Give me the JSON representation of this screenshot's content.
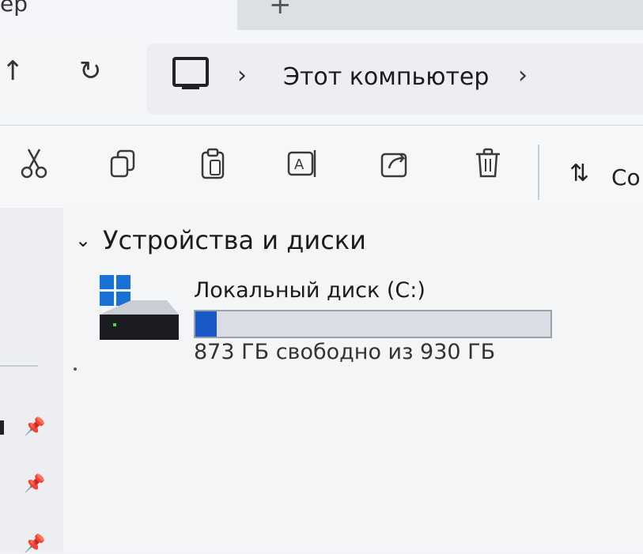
{
  "tabs": {
    "active_title_fragment": "ер",
    "new_tab_glyph": "+"
  },
  "navigation": {
    "up_glyph": "↑",
    "refresh_glyph": "↻",
    "separator_glyph": "›",
    "breadcrumb": [
      "Этот компьютер"
    ]
  },
  "toolbar": {
    "buttons": [
      {
        "name": "cut-icon",
        "icon": "cut"
      },
      {
        "name": "copy-icon",
        "icon": "copy"
      },
      {
        "name": "paste-icon",
        "icon": "paste"
      },
      {
        "name": "rename-icon",
        "icon": "rename"
      },
      {
        "name": "share-icon",
        "icon": "share"
      },
      {
        "name": "delete-icon",
        "icon": "delete"
      }
    ],
    "sort_glyph": "⇅",
    "sort_label": "Со"
  },
  "content": {
    "group_title": "Устройства и диски",
    "group_chevron": "⌄",
    "drives": [
      {
        "name": "Локальный диск (C:)",
        "free_text": "873 ГБ свободно из 930 ГБ",
        "used_fraction": 0.061,
        "accent": "#1a5ac8"
      }
    ]
  },
  "sidebar": {
    "pin_glyph": "📌"
  }
}
